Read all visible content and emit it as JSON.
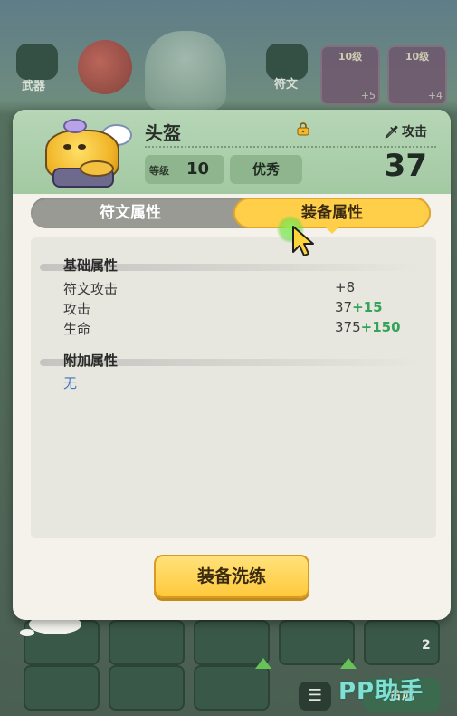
{
  "background": {
    "weapon_label": "武器",
    "rune_label": "符文",
    "slots": [
      {
        "level": "10级",
        "plus": "+5"
      },
      {
        "level": "10级",
        "plus": "+4"
      }
    ],
    "grid_count": "2",
    "merge_label": "合成",
    "watermark": "PP助手"
  },
  "item": {
    "name": "头盔",
    "attack_tag": "攻击",
    "level_label": "等级",
    "level_value": "10",
    "quality": "优秀",
    "power": "37",
    "icon": "helmet-icon",
    "lock_icon": "lock-icon"
  },
  "tabs": [
    {
      "label": "符文属性",
      "active": false
    },
    {
      "label": "装备属性",
      "active": true
    }
  ],
  "sections": {
    "base_title": "基础属性",
    "base_stats": [
      {
        "name": "符文攻击",
        "value": "+8",
        "bonus": ""
      },
      {
        "name": "攻击",
        "value": "37",
        "bonus": "+15"
      },
      {
        "name": "生命",
        "value": "375",
        "bonus": "+150"
      }
    ],
    "extra_title": "附加属性",
    "extra_value": "无"
  },
  "actions": {
    "refine_label": "装备洗练"
  },
  "colors": {
    "header_green": "#a3c9a3",
    "tab_active": "#ffcf4a",
    "bonus_green": "#35a35a",
    "none_blue": "#3f77b8"
  }
}
